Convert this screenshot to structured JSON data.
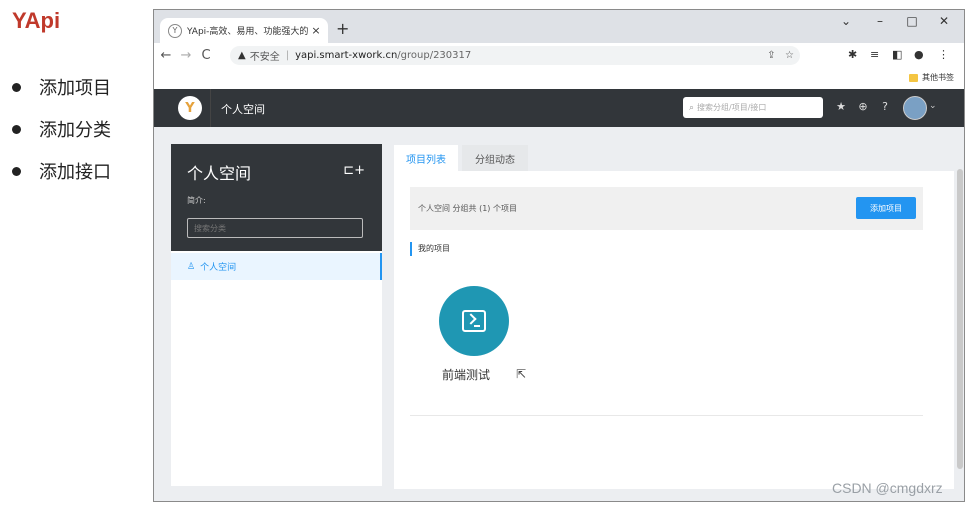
{
  "slide": {
    "title": "YApi",
    "bullets": [
      "添加项目",
      "添加分类",
      "添加接口"
    ]
  },
  "browser": {
    "tab_title": "YApi-高效、易用、功能强大的可",
    "tab_close": "×",
    "new_tab": "+",
    "window_controls": [
      "⌄",
      "–",
      "□",
      "✕"
    ],
    "nav": {
      "back": "←",
      "forward": "→",
      "reload": "C"
    },
    "address": {
      "warning_icon": "▲",
      "insecure_label": "不安全",
      "separator": "|",
      "host": "yapi.smart-xwork.cn",
      "path": "/group/230317"
    },
    "toolbar_icons": [
      "share-icon",
      "star-icon",
      "extension-icon",
      "media-icon",
      "sidepanel-icon",
      "profile-icon",
      "menu-icon"
    ],
    "bookmark_folder": "其他书签"
  },
  "yapi": {
    "nav_title": "个人空间",
    "search_placeholder": "搜索分组/项目/接口",
    "left": {
      "title": "个人空间",
      "desc_label": "简介:",
      "search_placeholder": "搜索分类",
      "items": [
        {
          "label": "个人空间"
        }
      ]
    },
    "tabs": [
      "项目列表",
      "分组动态"
    ],
    "info_text": "个人空间 分组共 (1) 个项目",
    "add_project_button": "添加项目",
    "section_label": "我的项目",
    "projects": [
      {
        "name": "前端测试"
      }
    ]
  },
  "watermark": "CSDN @cmgdxrz"
}
